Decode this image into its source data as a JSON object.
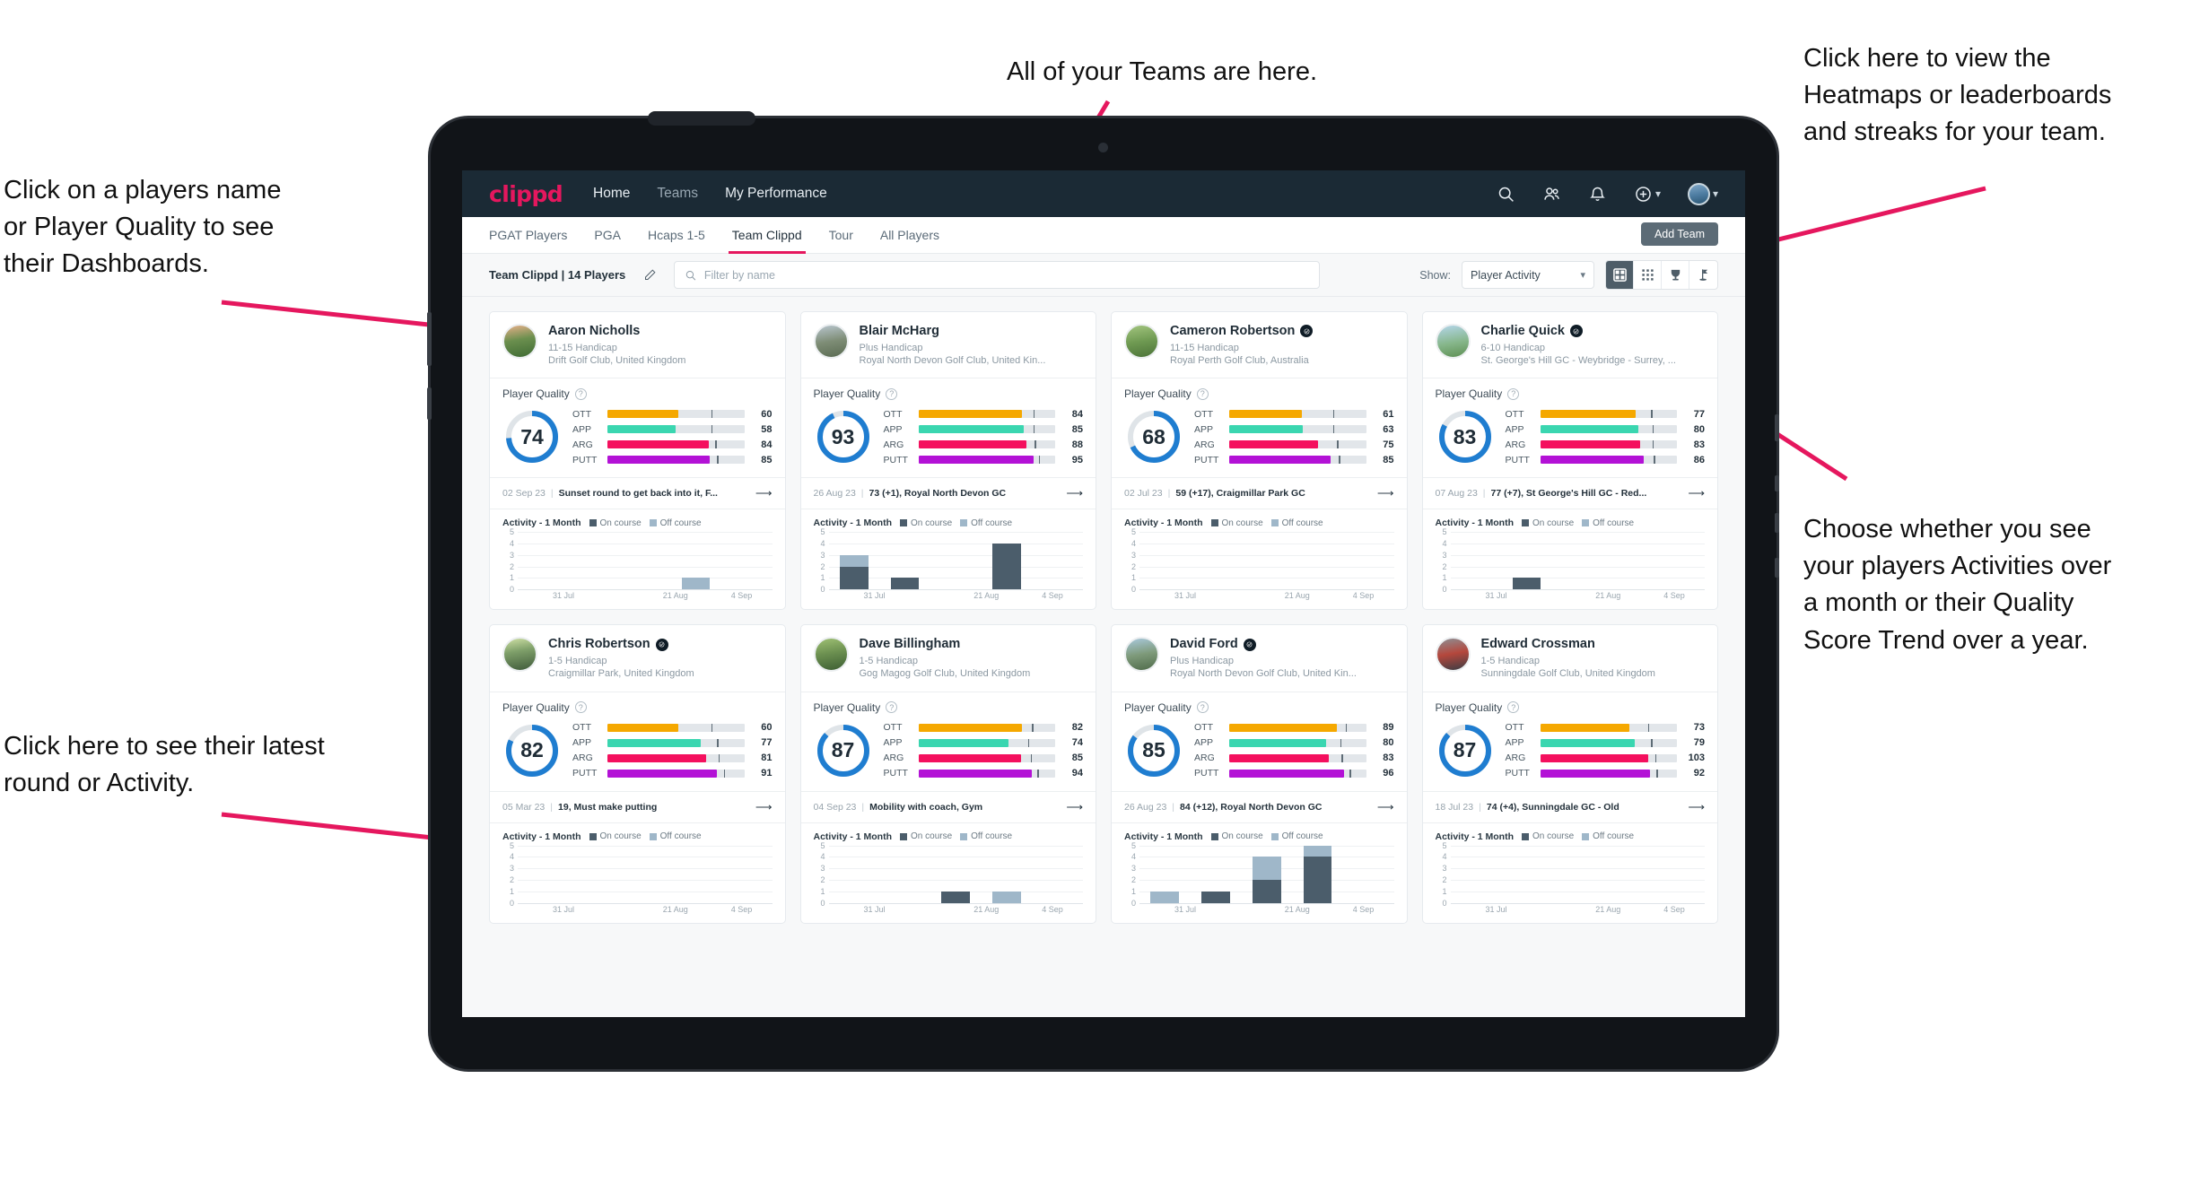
{
  "annotations": {
    "top_left": "Click on a players name\nor Player Quality to see\ntheir Dashboards.",
    "top_center": "All of your Teams are here.",
    "top_right": "Click here to view the\nHeatmaps or leaderboards\nand streaks for your team.",
    "middle_right": "Choose whether you see\nyour players Activities over\na month or their Quality\nScore Trend over a year.",
    "bottom_left": "Click here to see their latest\nround or Activity.",
    "arrow_color": "#e5175e"
  },
  "navbar": {
    "logo": "clippd",
    "links": [
      {
        "label": "Home",
        "active": true
      },
      {
        "label": "Teams",
        "active": false
      },
      {
        "label": "My Performance",
        "active": true
      }
    ],
    "icons": [
      "search-icon",
      "people-icon",
      "bell-icon",
      "plus-circle-icon",
      "avatar"
    ],
    "brand_color": "#e5175e",
    "bar_color": "#1b2a35"
  },
  "tabs": [
    {
      "label": "PGAT Players",
      "active": false
    },
    {
      "label": "PGA",
      "active": false
    },
    {
      "label": "Hcaps 1-5",
      "active": false
    },
    {
      "label": "Team Clippd",
      "active": true
    },
    {
      "label": "Tour",
      "active": false
    },
    {
      "label": "All Players",
      "active": false
    }
  ],
  "add_team_button": "Add Team",
  "toolbar": {
    "team_label": "Team Clippd | 14 Players",
    "edit_icon": "pencil-icon",
    "search_placeholder": "Filter by name",
    "search_value": "",
    "show_label": "Show:",
    "show_value": "Player Activity",
    "show_options": [
      "Player Activity",
      "Quality Score Trend"
    ],
    "view_modes": [
      {
        "name": "card-view",
        "active": true
      },
      {
        "name": "grid-view",
        "active": false
      },
      {
        "name": "trophy-view",
        "active": false
      },
      {
        "name": "flag-view",
        "active": false
      }
    ]
  },
  "card_labels": {
    "quality_title": "Player Quality",
    "activity_title": "Activity - 1 Month",
    "legend_on": "On course",
    "legend_off": "Off course",
    "metrics": [
      "OTT",
      "APP",
      "ARG",
      "PUTT"
    ],
    "x_ticks": [
      "31 Jul",
      "21 Aug",
      "4 Sep"
    ],
    "y_ticks": [
      "5",
      "4",
      "3",
      "2",
      "1",
      "0"
    ]
  },
  "metric_colors": {
    "OTT": "#f5a800",
    "APP": "#3ad6b0",
    "ARG": "#f4105e",
    "PUTT": "#b312d6",
    "donut": "#1f7dd0",
    "on_course": "#4b5d6b",
    "off_course": "#9fb7c9"
  },
  "players": [
    {
      "name": "Aaron Nicholls",
      "verified": false,
      "handicap": "11-15 Handicap",
      "club": "Drift Golf Club, United Kingdom",
      "quality": 74,
      "metrics": [
        {
          "label": "OTT",
          "value": 60,
          "fill": 52,
          "tick": 76
        },
        {
          "label": "APP",
          "value": 58,
          "fill": 50,
          "tick": 76
        },
        {
          "label": "ARG",
          "value": 84,
          "fill": 74,
          "tick": 79
        },
        {
          "label": "PUTT",
          "value": 85,
          "fill": 75,
          "tick": 80
        }
      ],
      "round_date": "02 Sep 23",
      "round_text": "Sunset round to get back into it, F...",
      "activity": [
        {
          "on": 0,
          "off": 0
        },
        {
          "on": 0,
          "off": 0
        },
        {
          "on": 0,
          "off": 0
        },
        {
          "on": 0,
          "off": 1
        },
        {
          "on": 0,
          "off": 0
        }
      ]
    },
    {
      "name": "Blair McHarg",
      "verified": false,
      "handicap": "Plus Handicap",
      "club": "Royal North Devon Golf Club, United Kin...",
      "quality": 93,
      "metrics": [
        {
          "label": "OTT",
          "value": 84,
          "fill": 76,
          "tick": 84
        },
        {
          "label": "APP",
          "value": 85,
          "fill": 77,
          "tick": 84
        },
        {
          "label": "ARG",
          "value": 88,
          "fill": 79,
          "tick": 85
        },
        {
          "label": "PUTT",
          "value": 95,
          "fill": 84,
          "tick": 88
        }
      ],
      "round_date": "26 Aug 23",
      "round_text": "73 (+1), Royal North Devon GC",
      "activity": [
        {
          "on": 2,
          "off": 1
        },
        {
          "on": 1,
          "off": 0
        },
        {
          "on": 0,
          "off": 0
        },
        {
          "on": 4,
          "off": 0
        },
        {
          "on": 0,
          "off": 0
        }
      ]
    },
    {
      "name": "Cameron Robertson",
      "verified": true,
      "handicap": "11-15 Handicap",
      "club": "Royal Perth Golf Club, Australia",
      "quality": 68,
      "metrics": [
        {
          "label": "OTT",
          "value": 61,
          "fill": 53,
          "tick": 76
        },
        {
          "label": "APP",
          "value": 63,
          "fill": 54,
          "tick": 76
        },
        {
          "label": "ARG",
          "value": 75,
          "fill": 65,
          "tick": 79
        },
        {
          "label": "PUTT",
          "value": 85,
          "fill": 74,
          "tick": 80
        }
      ],
      "round_date": "02 Jul 23",
      "round_text": "59 (+17), Craigmillar Park GC",
      "activity": [
        {
          "on": 0,
          "off": 0
        },
        {
          "on": 0,
          "off": 0
        },
        {
          "on": 0,
          "off": 0
        },
        {
          "on": 0,
          "off": 0
        },
        {
          "on": 0,
          "off": 0
        }
      ]
    },
    {
      "name": "Charlie Quick",
      "verified": true,
      "handicap": "6-10 Handicap",
      "club": "St. George's Hill GC - Weybridge - Surrey, ...",
      "quality": 83,
      "metrics": [
        {
          "label": "OTT",
          "value": 77,
          "fill": 70,
          "tick": 81
        },
        {
          "label": "APP",
          "value": 80,
          "fill": 72,
          "tick": 82
        },
        {
          "label": "ARG",
          "value": 83,
          "fill": 73,
          "tick": 82
        },
        {
          "label": "PUTT",
          "value": 86,
          "fill": 76,
          "tick": 83
        }
      ],
      "round_date": "07 Aug 23",
      "round_text": "77 (+7), St George's Hill GC - Red...",
      "activity": [
        {
          "on": 0,
          "off": 0
        },
        {
          "on": 1,
          "off": 0
        },
        {
          "on": 0,
          "off": 0
        },
        {
          "on": 0,
          "off": 0
        },
        {
          "on": 0,
          "off": 0
        }
      ]
    },
    {
      "name": "Chris Robertson",
      "verified": true,
      "handicap": "1-5 Handicap",
      "club": "Craigmillar Park, United Kingdom",
      "quality": 82,
      "metrics": [
        {
          "label": "OTT",
          "value": 60,
          "fill": 52,
          "tick": 76
        },
        {
          "label": "APP",
          "value": 77,
          "fill": 68,
          "tick": 80
        },
        {
          "label": "ARG",
          "value": 81,
          "fill": 72,
          "tick": 81
        },
        {
          "label": "PUTT",
          "value": 91,
          "fill": 80,
          "tick": 85
        }
      ],
      "round_date": "05 Mar 23",
      "round_text": "19, Must make putting",
      "activity": [
        {
          "on": 0,
          "off": 0
        },
        {
          "on": 0,
          "off": 0
        },
        {
          "on": 0,
          "off": 0
        },
        {
          "on": 0,
          "off": 0
        },
        {
          "on": 0,
          "off": 0
        }
      ]
    },
    {
      "name": "Dave Billingham",
      "verified": false,
      "handicap": "1-5 Handicap",
      "club": "Gog Magog Golf Club, United Kingdom",
      "quality": 87,
      "metrics": [
        {
          "label": "OTT",
          "value": 82,
          "fill": 76,
          "tick": 83
        },
        {
          "label": "APP",
          "value": 74,
          "fill": 66,
          "tick": 80
        },
        {
          "label": "ARG",
          "value": 85,
          "fill": 75,
          "tick": 82
        },
        {
          "label": "PUTT",
          "value": 94,
          "fill": 83,
          "tick": 87
        }
      ],
      "round_date": "04 Sep 23",
      "round_text": "Mobility with coach, Gym",
      "activity": [
        {
          "on": 0,
          "off": 0
        },
        {
          "on": 0,
          "off": 0
        },
        {
          "on": 1,
          "off": 0
        },
        {
          "on": 0,
          "off": 1
        },
        {
          "on": 0,
          "off": 0
        }
      ]
    },
    {
      "name": "David Ford",
      "verified": true,
      "handicap": "Plus Handicap",
      "club": "Royal North Devon Golf Club, United Kin...",
      "quality": 85,
      "metrics": [
        {
          "label": "OTT",
          "value": 89,
          "fill": 79,
          "tick": 85
        },
        {
          "label": "APP",
          "value": 80,
          "fill": 71,
          "tick": 81
        },
        {
          "label": "ARG",
          "value": 83,
          "fill": 73,
          "tick": 82
        },
        {
          "label": "PUTT",
          "value": 96,
          "fill": 84,
          "tick": 88
        }
      ],
      "round_date": "26 Aug 23",
      "round_text": "84 (+12), Royal North Devon GC",
      "activity": [
        {
          "on": 0,
          "off": 1
        },
        {
          "on": 1,
          "off": 0
        },
        {
          "on": 2,
          "off": 2
        },
        {
          "on": 4,
          "off": 1
        },
        {
          "on": 0,
          "off": 0
        }
      ]
    },
    {
      "name": "Edward Crossman",
      "verified": false,
      "handicap": "1-5 Handicap",
      "club": "Sunningdale Golf Club, United Kingdom",
      "quality": 87,
      "metrics": [
        {
          "label": "OTT",
          "value": 73,
          "fill": 65,
          "tick": 79
        },
        {
          "label": "APP",
          "value": 79,
          "fill": 69,
          "tick": 81
        },
        {
          "label": "ARG",
          "value": 103,
          "fill": 79,
          "tick": 84
        },
        {
          "label": "PUTT",
          "value": 92,
          "fill": 80,
          "tick": 85
        }
      ],
      "round_date": "18 Jul 23",
      "round_text": "74 (+4), Sunningdale GC - Old",
      "activity": [
        {
          "on": 0,
          "off": 0
        },
        {
          "on": 0,
          "off": 0
        },
        {
          "on": 0,
          "off": 0
        },
        {
          "on": 0,
          "off": 0
        },
        {
          "on": 0,
          "off": 0
        }
      ]
    }
  ]
}
